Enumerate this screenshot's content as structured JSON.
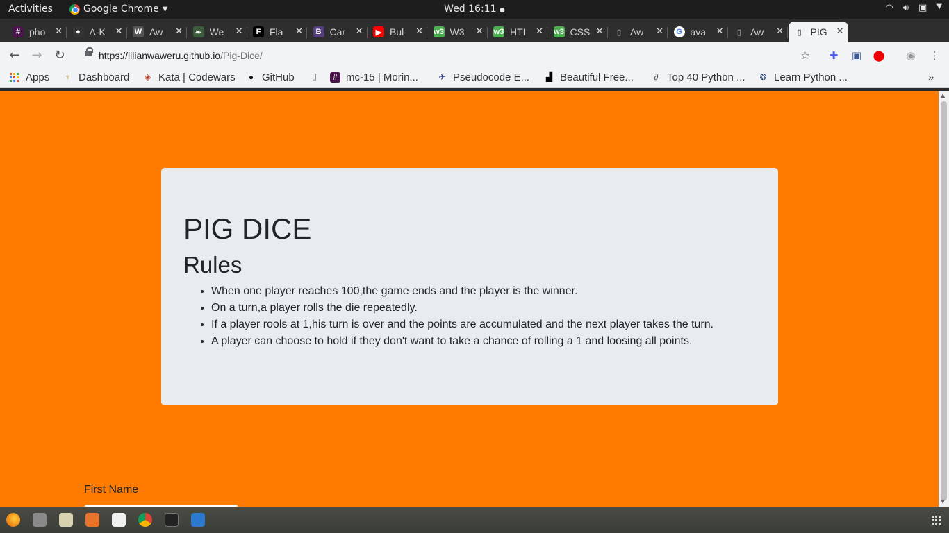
{
  "system_bar": {
    "activities": "Activities",
    "app_name": "Google Chrome",
    "clock": "Wed 16:11"
  },
  "tabs": [
    {
      "title": "pho",
      "icon": "slack-icon",
      "color": "#4a154b"
    },
    {
      "title": "A-K",
      "icon": "github-icon",
      "color": "#333333"
    },
    {
      "title": "Aw",
      "icon": "w-icon",
      "color": "#555555"
    },
    {
      "title": "We",
      "icon": "leaf-icon",
      "color": "#3b5b3b"
    },
    {
      "title": "Fla",
      "icon": "flask-icon",
      "color": "#000000"
    },
    {
      "title": "Car",
      "icon": "bootstrap-icon",
      "color": "#563d7c"
    },
    {
      "title": "Bul",
      "icon": "youtube-icon",
      "color": "#ff0000"
    },
    {
      "title": "W3",
      "icon": "w3schools-icon",
      "color": "#4caf50"
    },
    {
      "title": "HTI",
      "icon": "w3schools-icon",
      "color": "#4caf50"
    },
    {
      "title": "CSS",
      "icon": "w3schools-icon",
      "color": "#4caf50"
    },
    {
      "title": "Aw",
      "icon": "page-icon",
      "color": "#555555"
    },
    {
      "title": "ava",
      "icon": "google-icon",
      "color": "#ffffff"
    },
    {
      "title": "Aw",
      "icon": "page-icon",
      "color": "#555555"
    },
    {
      "title": "PIG",
      "icon": "page-icon",
      "color": "#f2f3f5",
      "active": true
    }
  ],
  "address_bar": {
    "url_host": "https://lilianwaweru.github.io",
    "url_path": "/Pig-Dice/"
  },
  "bookmarks": [
    {
      "label": "Apps",
      "icon": "apps-grid-icon"
    },
    {
      "label": "Dashboard",
      "icon": "dashboard-icon"
    },
    {
      "label": "Kata | Codewars",
      "icon": "codewars-icon"
    },
    {
      "label": "GitHub",
      "icon": "github-icon"
    },
    {
      "label": "",
      "icon": "page-icon"
    },
    {
      "label": "mc-15 | Morin...",
      "icon": "slack-icon"
    },
    {
      "label": "Pseudocode E...",
      "icon": "pseudocode-icon"
    },
    {
      "label": "Beautiful Free...",
      "icon": "unsplash-icon"
    },
    {
      "label": "Top 40 Python ...",
      "icon": "link-icon"
    },
    {
      "label": "Learn Python ...",
      "icon": "python-icon"
    }
  ],
  "page": {
    "background": "#ff7b00",
    "title": "PIG DICE",
    "rules_heading": "Rules",
    "rules": [
      "When one player reaches 100,the game ends and the player is the winner.",
      "On a turn,a player rolls the die repeatedly.",
      "If a player rools at 1,his turn is over and the points are accumulated and the next player takes the turn.",
      "A player can choose to hold if they don't want to take a chance of rolling a 1 and loosing all points."
    ],
    "first_name_label": "First Name",
    "first_name_value": ""
  }
}
